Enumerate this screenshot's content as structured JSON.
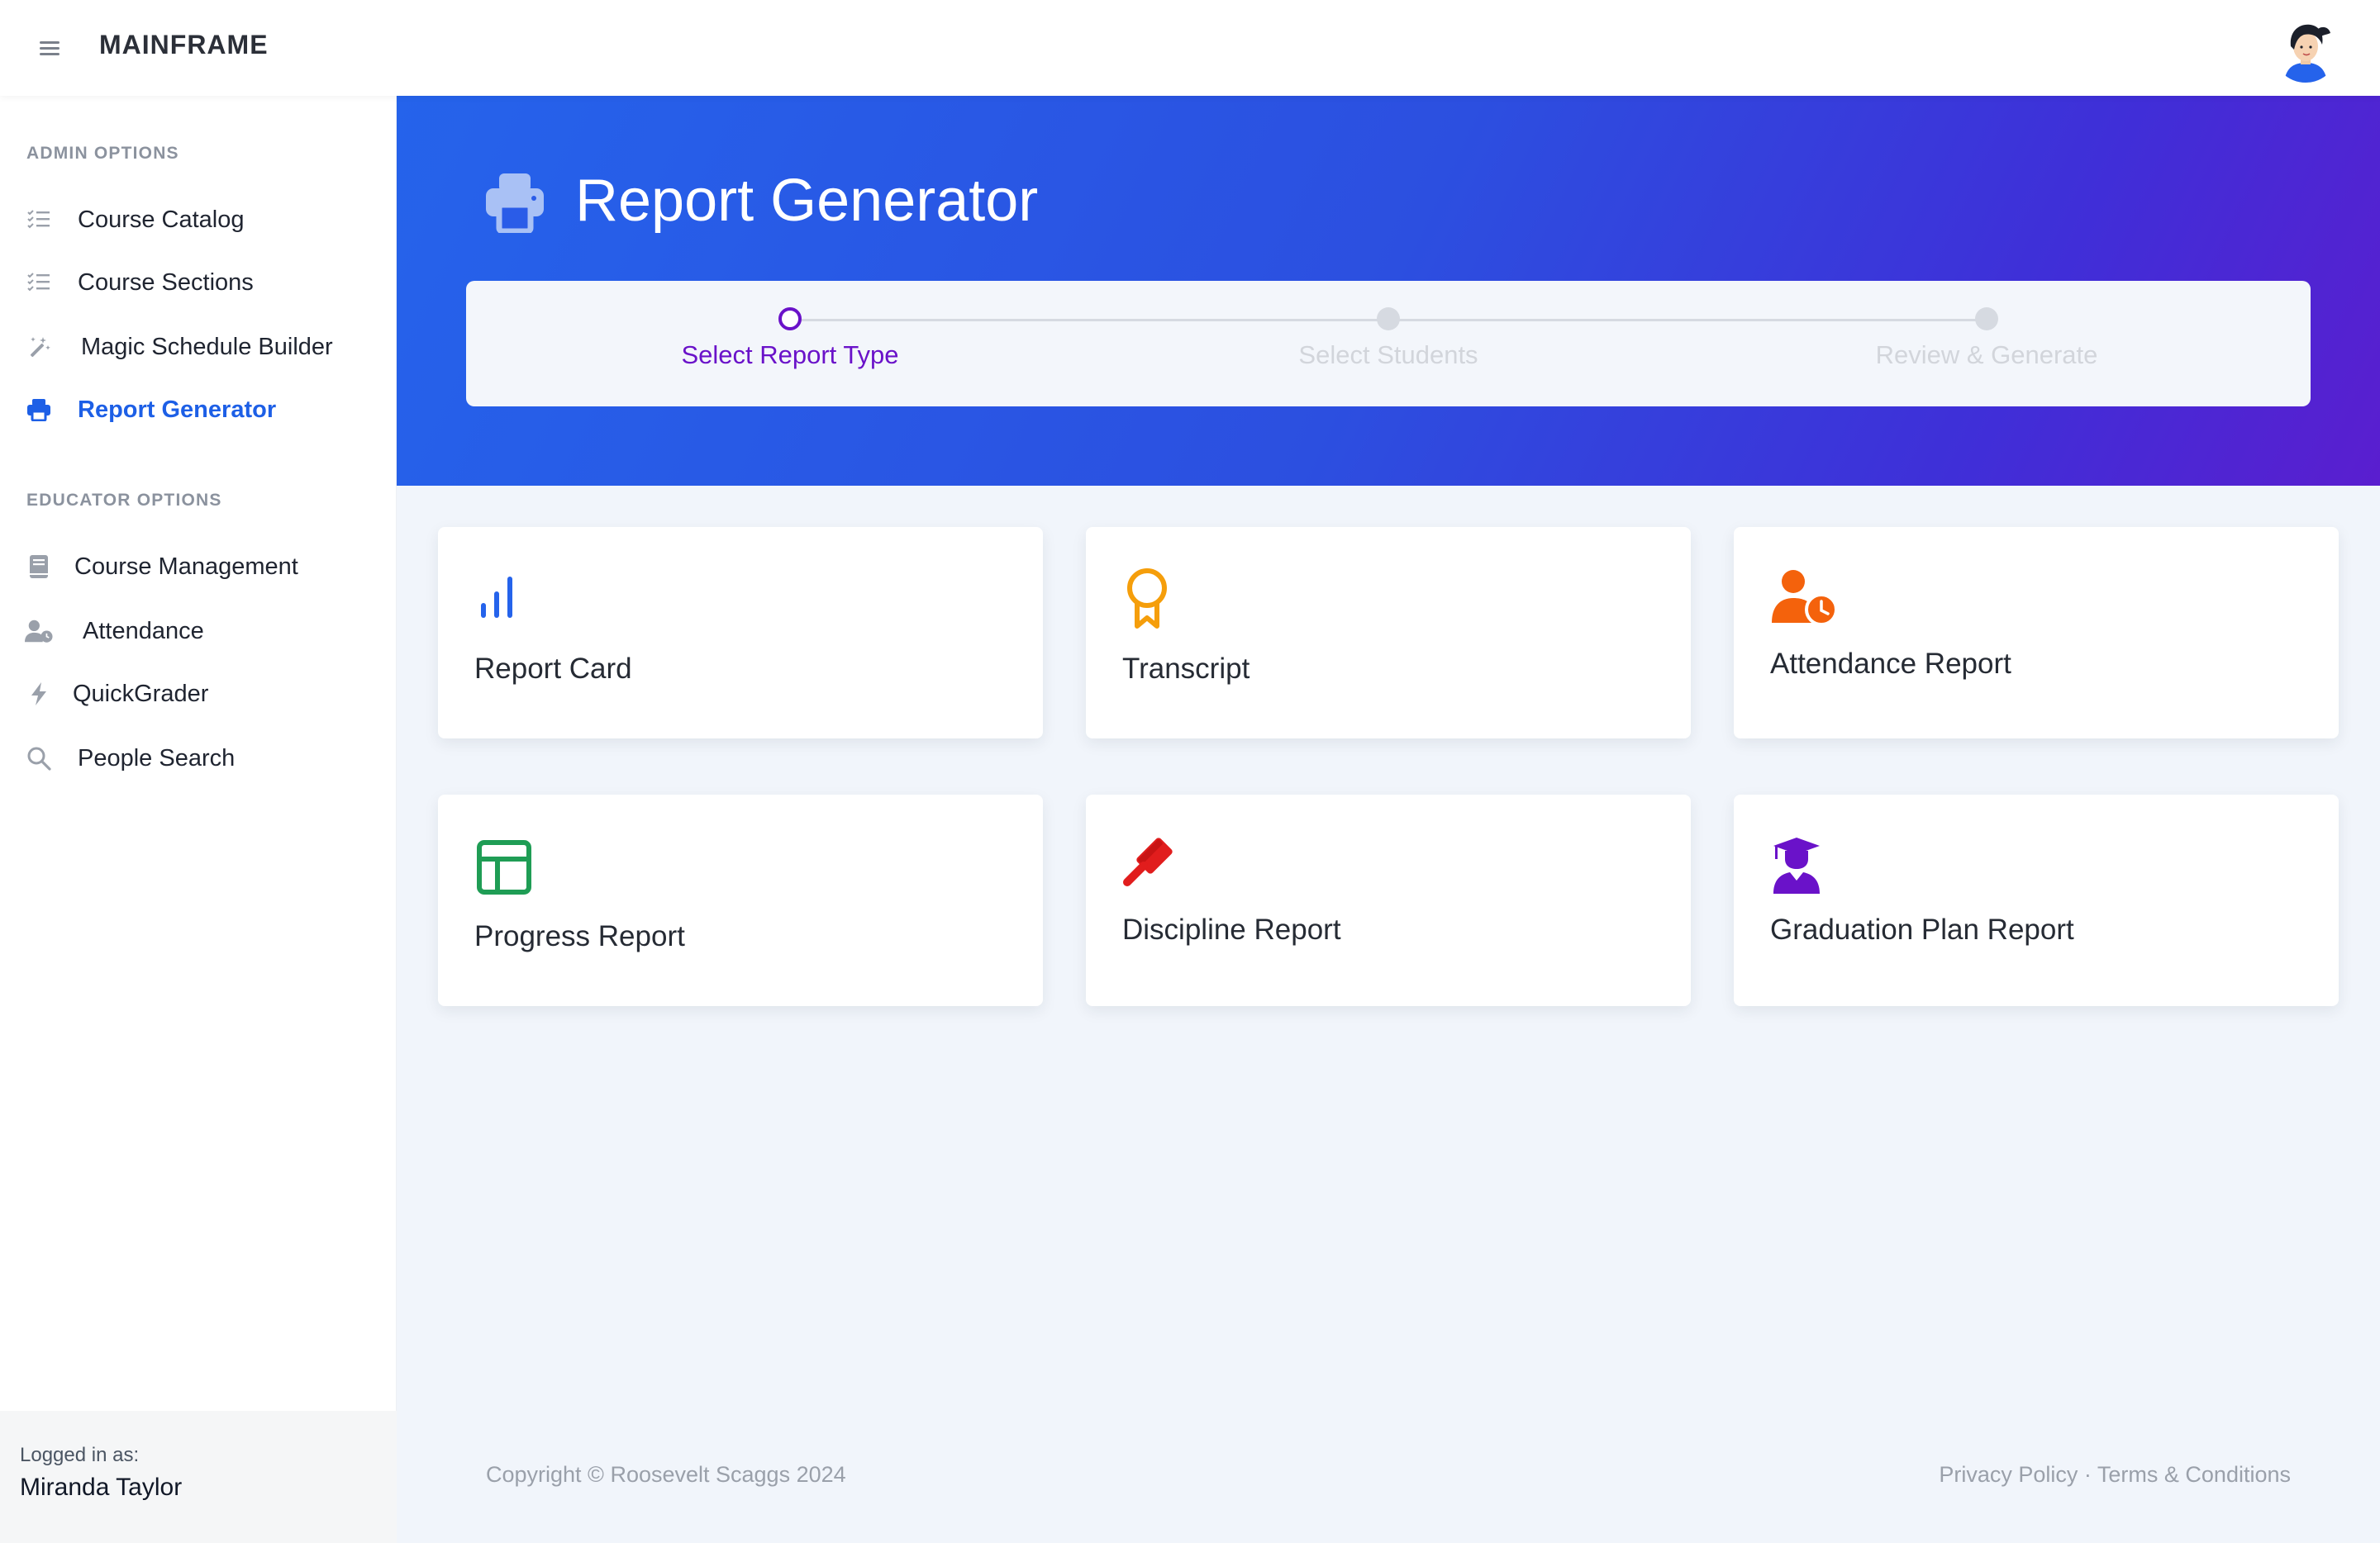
{
  "app": {
    "brand": "MAINFRAME"
  },
  "sidebar": {
    "sections": [
      {
        "title": "ADMIN OPTIONS",
        "items": [
          {
            "label": "Course Catalog",
            "icon": "list-check-icon"
          },
          {
            "label": "Course Sections",
            "icon": "list-check-icon"
          },
          {
            "label": "Magic Schedule Builder",
            "icon": "magic-wand-icon"
          },
          {
            "label": "Report Generator",
            "icon": "printer-icon",
            "active": true
          }
        ]
      },
      {
        "title": "EDUCATOR OPTIONS",
        "items": [
          {
            "label": "Course Management",
            "icon": "book-icon"
          },
          {
            "label": "Attendance",
            "icon": "user-clock-icon"
          },
          {
            "label": "QuickGrader",
            "icon": "lightning-icon"
          },
          {
            "label": "People Search",
            "icon": "search-icon"
          }
        ]
      }
    ],
    "logged_in_label": "Logged in as:",
    "user_name": "Miranda Taylor"
  },
  "hero": {
    "title": "Report Generator",
    "icon": "printer-icon",
    "steps": [
      {
        "label": "Select Report Type",
        "active": true
      },
      {
        "label": "Select Students",
        "active": false
      },
      {
        "label": "Review & Generate",
        "active": false
      }
    ]
  },
  "cards": [
    {
      "label": "Report Card",
      "icon": "bar-chart-icon",
      "color": "#2563eb"
    },
    {
      "label": "Transcript",
      "icon": "award-ribbon-icon",
      "color": "#f59e0b"
    },
    {
      "label": "Attendance Report",
      "icon": "user-clock-icon",
      "color": "#f4620c"
    },
    {
      "label": "Progress Report",
      "icon": "layout-panel-icon",
      "color": "#1f9d55"
    },
    {
      "label": "Discipline Report",
      "icon": "gavel-icon",
      "color": "#e11d1d"
    },
    {
      "label": "Graduation Plan Report",
      "icon": "graduate-user-icon",
      "color": "#6a12c9"
    }
  ],
  "footer": {
    "copyright": "Copyright © Roosevelt Scaggs 2024",
    "privacy": "Privacy Policy",
    "separator": " · ",
    "terms": "Terms & Conditions"
  },
  "colors": {
    "accent": "#1d5fe6",
    "step_active": "#6a12c9"
  }
}
